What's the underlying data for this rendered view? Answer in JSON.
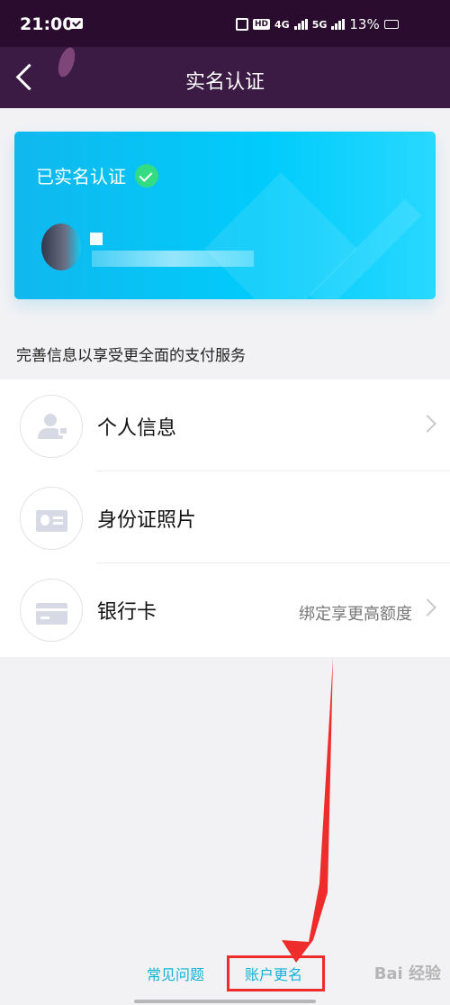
{
  "status_bar": {
    "time": "21:00",
    "network_labels": [
      "HD",
      "4G",
      "5G"
    ],
    "battery": "13%"
  },
  "header": {
    "title": "实名认证",
    "icons": [
      "back-arrow-icon"
    ]
  },
  "verification_card": {
    "status_text": "已实名认证",
    "status_icon": "check-circle-icon",
    "colors": {
      "card_start": "#10b8ee",
      "card_end": "#28d8ff",
      "check": "#33dc83"
    }
  },
  "hint": {
    "text": "完善信息以享受更全面的支付服务"
  },
  "menu": {
    "items": [
      {
        "label": "个人信息",
        "icon": "personal-info-icon",
        "subtext": ""
      },
      {
        "label": "身份证照片",
        "icon": "id-card-icon",
        "subtext": ""
      },
      {
        "label": "银行卡",
        "icon": "bank-card-icon",
        "subtext": "绑定享更高额度"
      }
    ]
  },
  "footer": {
    "faq_label": "常见问题",
    "rename_label": "账户更名",
    "highlight_color": "#ef2c2c",
    "link_color": "#14b2d9"
  },
  "watermark": {
    "text": "Bai 经验"
  }
}
